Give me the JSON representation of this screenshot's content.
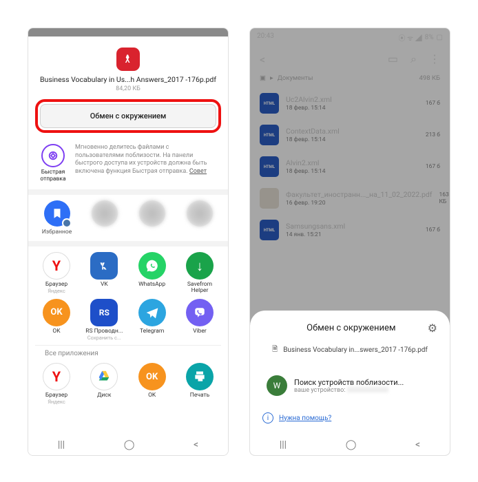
{
  "left": {
    "file_name": "Business Vocabulary in Us...h Answers_2017 -176p.pdf",
    "file_size": "84,20 КБ",
    "nearby_button": "Обмен с окружением",
    "quick_share": {
      "label": "Быстрая отправка",
      "desc": "Мгновенно делитесь файлами с пользователями поблизости. На панели быстрого доступа их устройств должна быть включена функция Быстрая отправка. ",
      "tip": "Совет"
    },
    "favorites_label": "Избранное",
    "apps_row1": [
      {
        "name": "Браузер",
        "sub": "Яндекс",
        "bg": "#fff",
        "letter": "Y",
        "color": "#e11"
      },
      {
        "name": "VK",
        "sub": "",
        "bg": "#2b6cc4",
        "letter": "W",
        "color": "#fff"
      },
      {
        "name": "WhatsApp",
        "sub": "",
        "bg": "#25d366",
        "letter": "",
        "color": "#fff"
      },
      {
        "name": "Savefrom Helper",
        "sub": "",
        "bg": "#1aa34a",
        "letter": "↓",
        "color": "#fff"
      }
    ],
    "apps_row2": [
      {
        "name": "OK",
        "sub": "",
        "bg": "#f7931e",
        "letter": "OK",
        "color": "#fff"
      },
      {
        "name": "RS Проводн...",
        "sub": "Сохранить с...",
        "bg": "#1e4fc9",
        "letter": "RS",
        "color": "#fff"
      },
      {
        "name": "Telegram",
        "sub": "",
        "bg": "#2ca5e0",
        "letter": "",
        "color": "#fff"
      },
      {
        "name": "Viber",
        "sub": "",
        "bg": "#7360f2",
        "letter": "",
        "color": "#fff"
      }
    ],
    "all_apps": "Все приложения",
    "apps_row3": [
      {
        "name": "Браузер",
        "sub": "Яндекс",
        "bg": "#fff",
        "letter": "Y",
        "color": "#e11"
      },
      {
        "name": "Диск",
        "sub": "",
        "bg": "#fff",
        "letter": "▲",
        "color": "#1da462"
      },
      {
        "name": "OK",
        "sub": "",
        "bg": "#f7931e",
        "letter": "OK",
        "color": "#fff"
      },
      {
        "name": "Печать",
        "sub": "",
        "bg": "#0aa4a8",
        "letter": "",
        "color": "#fff"
      }
    ]
  },
  "right": {
    "time": "20:43",
    "battery": "8%",
    "crumb_folder": "Документы",
    "crumb_size": "498 КБ",
    "files": [
      {
        "name": "Uc2Alvin2.xml",
        "meta": "18 февр. 15:14",
        "size": "167 б",
        "type": "HTML"
      },
      {
        "name": "ContextData.xml",
        "meta": "18 февр. 15:14",
        "size": "213 б",
        "type": "HTML"
      },
      {
        "name": "Alvin2.xml",
        "meta": "18 февр. 15:14",
        "size": "167 б",
        "type": "HTML"
      },
      {
        "name": "Факультет_иностранн..._на_11_02_2022.pdf",
        "meta": "16 февр. 19:20",
        "size": "163 КБ",
        "type": "PDF"
      },
      {
        "name": "Samsungsans.xml",
        "meta": "14 янв. 15:21",
        "size": "167 б",
        "type": "HTML"
      }
    ],
    "bs_title": "Обмен с окружением",
    "bs_file": "Business Vocabulary in...swers_2017 -176p.pdf",
    "bs_avatar": "W",
    "bs_search": "Поиск устройств поблизости...",
    "bs_device": "ваше устройство: ",
    "bs_help": "Нужна помощь?"
  }
}
